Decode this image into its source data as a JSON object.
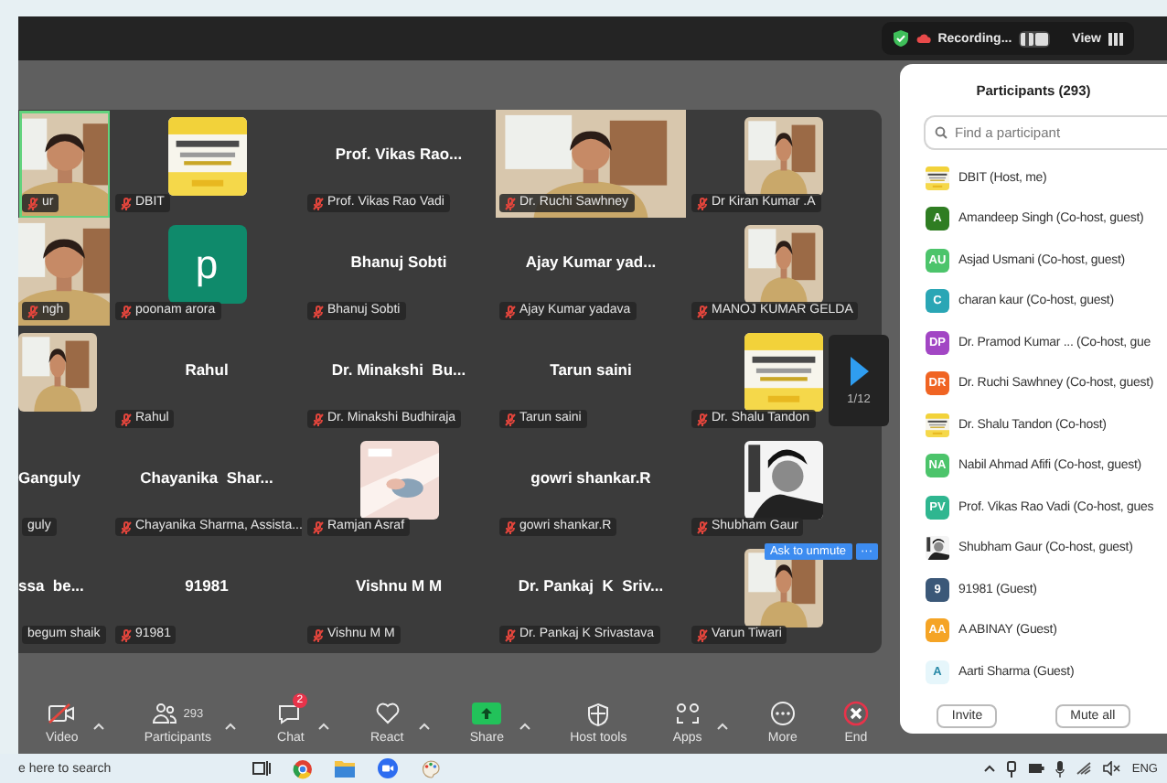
{
  "top_bar": {
    "recording": "Recording...",
    "view": "View"
  },
  "gallery": {
    "page": "1/12",
    "tiles": [
      {
        "kind": "video",
        "label": "ur",
        "muted": true,
        "speaking": true
      },
      {
        "kind": "picture",
        "label": "DBIT",
        "muted": true,
        "speaking": false
      },
      {
        "kind": "name",
        "name": "Prof. Vikas Rao...",
        "label": "Prof. Vikas Rao Vadi",
        "muted": true,
        "speaking": false
      },
      {
        "kind": "video",
        "label": "Dr. Ruchi Sawhney",
        "muted": true,
        "speaking": false
      },
      {
        "kind": "picture",
        "label": "Dr Kiran Kumar .A",
        "muted": true,
        "speaking": false
      },
      {
        "kind": "video",
        "label": "ngh",
        "muted": true,
        "speaking": false
      },
      {
        "kind": "avatar",
        "initial": "p",
        "label": "poonam arora",
        "muted": true,
        "speaking": false
      },
      {
        "kind": "name",
        "name": "Bhanuj Sobti",
        "label": "Bhanuj Sobti",
        "muted": true,
        "speaking": false
      },
      {
        "kind": "name",
        "name": "Ajay Kumar yad...",
        "label": "Ajay Kumar yadava",
        "muted": true,
        "speaking": false
      },
      {
        "kind": "picture",
        "label": "MANOJ KUMAR GELDA",
        "muted": true,
        "speaking": false
      },
      {
        "kind": "picture",
        "speaking": false
      },
      {
        "kind": "name",
        "name": "Rahul",
        "label": "Rahul",
        "muted": true,
        "speaking": false
      },
      {
        "kind": "name",
        "name": "Dr. Minakshi  Bu...",
        "label": "Dr. Minakshi Budhiraja",
        "muted": true,
        "speaking": false
      },
      {
        "kind": "name",
        "name": "Tarun saini",
        "label": "Tarun saini",
        "muted": true,
        "speaking": false
      },
      {
        "kind": "picture",
        "label": "Dr. Shalu Tandon",
        "muted": true,
        "speaking": false
      },
      {
        "kind": "name",
        "name": "Ganguly",
        "label": "guly",
        "muted": false,
        "speaking": false
      },
      {
        "kind": "name",
        "name": "Chayanika  Shar...",
        "label": "Chayanika Sharma, Assista...",
        "muted": true,
        "speaking": false
      },
      {
        "kind": "picture",
        "label": "Ramjan Asraf",
        "muted": true,
        "speaking": false
      },
      {
        "kind": "name",
        "name": "gowri shankar.R",
        "label": "gowri shankar.R",
        "muted": true,
        "speaking": false
      },
      {
        "kind": "picture",
        "label": "Shubham Gaur",
        "muted": true,
        "speaking": false
      },
      {
        "kind": "name",
        "name": "ssa  be...",
        "label": "begum shaik",
        "muted": false,
        "speaking": false
      },
      {
        "kind": "name",
        "name": "91981",
        "label": "91981",
        "muted": true,
        "speaking": false
      },
      {
        "kind": "name",
        "name": "Vishnu M M",
        "label": "Vishnu M M",
        "muted": true,
        "speaking": false
      },
      {
        "kind": "name",
        "name": "Dr. Pankaj  K  Sriv...",
        "label": "Dr. Pankaj K Srivastava",
        "muted": true,
        "speaking": false
      },
      {
        "kind": "picture",
        "label": "Varun Tiwari",
        "muted": true,
        "speaking": false,
        "actions": [
          "Ask to unmute",
          "···"
        ]
      }
    ]
  },
  "toolbar": {
    "buttons": [
      {
        "kind": "video",
        "label": "Video",
        "caret": true
      },
      {
        "kind": "participants",
        "label": "Participants",
        "count": "293",
        "caret": true
      },
      {
        "kind": "chat",
        "label": "Chat",
        "badge": "2",
        "caret": true
      },
      {
        "kind": "react",
        "label": "React",
        "caret": true
      },
      {
        "kind": "share",
        "label": "Share",
        "caret": true
      },
      {
        "kind": "host",
        "label": "Host tools",
        "caret": false
      },
      {
        "kind": "apps",
        "label": "Apps",
        "caret": true
      },
      {
        "kind": "more",
        "label": "More",
        "caret": false
      },
      {
        "kind": "end",
        "label": "End",
        "caret": false
      }
    ]
  },
  "participants": {
    "title": "Participants (293)",
    "search": {
      "placeholder": "Find a participant"
    },
    "items": [
      {
        "kind": "picture",
        "name": "DBIT (Host, me)"
      },
      {
        "kind": "initials",
        "initials": "A",
        "color": "#2f7d22",
        "name": "Amandeep Singh (Co-host, guest)"
      },
      {
        "kind": "initials",
        "initials": "AU",
        "color": "#4cc46b",
        "name": "Asjad Usmani (Co-host, guest)"
      },
      {
        "kind": "initials",
        "initials": "C",
        "color": "#2aa6b5",
        "name": "charan kaur (Co-host, guest)"
      },
      {
        "kind": "initials",
        "initials": "DP",
        "color": "#a246c4",
        "name": "Dr. Pramod Kumar ... (Co-host, gue"
      },
      {
        "kind": "initials",
        "initials": "DR",
        "color": "#f06423",
        "name": "Dr. Ruchi Sawhney (Co-host, guest)"
      },
      {
        "kind": "picture",
        "name": "Dr. Shalu Tandon (Co-host)"
      },
      {
        "kind": "initials",
        "initials": "NA",
        "color": "#4cc46b",
        "name": "Nabil Ahmad Afifi (Co-host, guest)"
      },
      {
        "kind": "initials",
        "initials": "PV",
        "color": "#2fb690",
        "name": "Prof. Vikas Rao Vadi (Co-host, gues"
      },
      {
        "kind": "picture",
        "name": "Shubham Gaur (Co-host, guest)"
      },
      {
        "kind": "initials",
        "initials": "9",
        "color": "#3b5878",
        "name": "91981 (Guest)"
      },
      {
        "kind": "initials",
        "initials": "AA",
        "color": "#f5a425",
        "name": "A ABINAY (Guest)"
      },
      {
        "kind": "initials",
        "initials": "A",
        "color": "#e6f6fb",
        "name": "Aarti Sharma (Guest)"
      }
    ],
    "buttons": [
      "Invite",
      "Mute all"
    ]
  },
  "taskbar": {
    "search": {
      "placeholder": "e here to search"
    },
    "language": "ENG"
  }
}
